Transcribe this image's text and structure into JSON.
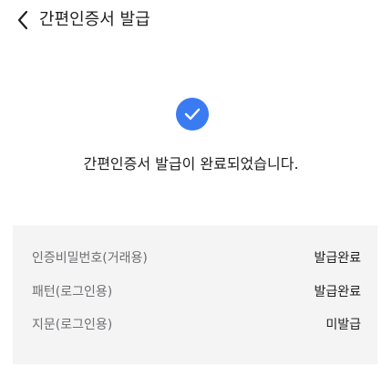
{
  "header": {
    "title": "간편인증서 발급",
    "back_icon": "chevron-left-icon"
  },
  "result": {
    "icon": "check-circle-icon",
    "icon_color": "#3a7bf2",
    "message": "간편인증서 발급이 완료되었습니다."
  },
  "status_list": {
    "background": "#f4f4f5",
    "rows": [
      {
        "label": "인증비밀번호(거래용)",
        "value": "발급완료"
      },
      {
        "label": "패턴(로그인용)",
        "value": "발급완료"
      },
      {
        "label": "지문(로그인용)",
        "value": "미발급"
      }
    ]
  }
}
